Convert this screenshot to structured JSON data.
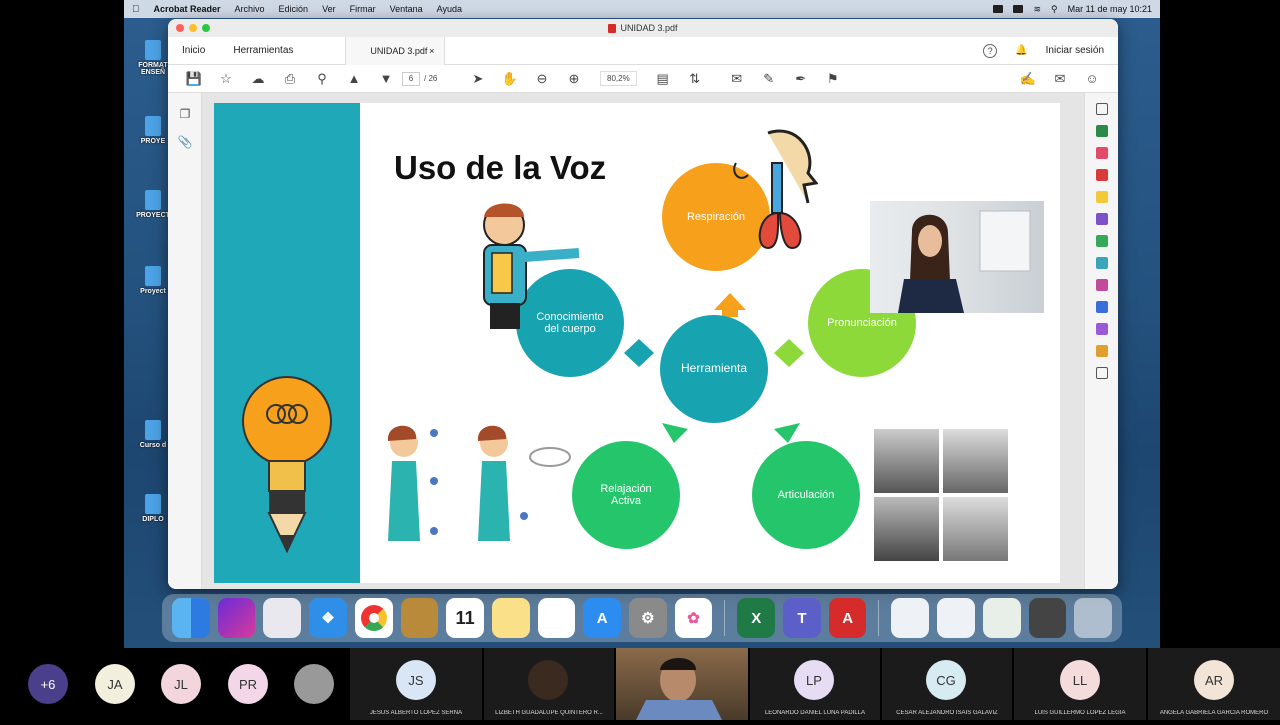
{
  "menubar": {
    "app_name": "Acrobat Reader",
    "items": [
      "Archivo",
      "Edición",
      "Ver",
      "Firmar",
      "Ventana",
      "Ayuda"
    ],
    "datetime": "Mar 11 de may  10:21"
  },
  "window": {
    "title": "UNIDAD 3.pdf",
    "tabs": {
      "home": "Inicio",
      "tools": "Herramientas",
      "doc": "UNIDAD 3.pdf",
      "close": "×"
    },
    "signin": "Iniciar sesión",
    "help": "?"
  },
  "toolbar": {
    "page_current": "6",
    "page_total": "/ 26",
    "zoom": "80,2%"
  },
  "slide": {
    "title": "Uso de la Voz",
    "center": "Herramienta",
    "respiracion": "Respiración",
    "pronunciacion": "Pronunciación",
    "articulacion": "Articulación",
    "relajacion": "Relajación Activa",
    "conocimiento": "Conocimiento del cuerpo",
    "colors": {
      "teal": "#1ea8b8",
      "orange": "#f7a01c",
      "lime": "#8ed93a",
      "green": "#25c66b",
      "dark_teal": "#17a3b0"
    }
  },
  "desktop_icons": [
    "FORMAT ENSEÑ",
    "PROYE",
    "PROYECT",
    "Proyect",
    "Curso d",
    "DIPLO"
  ],
  "dock": [
    "Finder",
    "Siri",
    "Launchpad",
    "Safari",
    "Chrome",
    "Notes",
    "Calendar",
    "Notes2",
    "Reminders",
    "App Store",
    "Settings",
    "Photos",
    "Excel",
    "Teams",
    "Acrobat"
  ],
  "participants": {
    "more": "+6",
    "avatars": [
      {
        "initials": "JA",
        "color": "#f2efdc"
      },
      {
        "initials": "JL",
        "color": "#f3d6dd"
      },
      {
        "initials": "PR",
        "color": "#f3d6e8"
      }
    ],
    "tiles": [
      {
        "initials": "JS",
        "name": "JESUS ALBERTO LOPEZ SERNA",
        "color": "#d9e6f5"
      },
      {
        "initials": "",
        "name": "LIZBETH GUADALUPE QUINTERO R...",
        "color": "#3a2a20"
      },
      {
        "initials": "LP",
        "name": "LEONARDO DANIEL LUNA PADILLA",
        "color": "#e6ddf5"
      },
      {
        "initials": "CG",
        "name": "CESAR ALEJANDRO ISAIS GALAVIZ",
        "color": "#d6ecf2"
      },
      {
        "initials": "LL",
        "name": "LUIS GUILLERMO LOPEZ LEGIA",
        "color": "#f5dcdc"
      },
      {
        "initials": "AR",
        "name": "ANGELA GABRIELA GARCIA ROMERO",
        "color": "#f2e4d6"
      }
    ]
  }
}
